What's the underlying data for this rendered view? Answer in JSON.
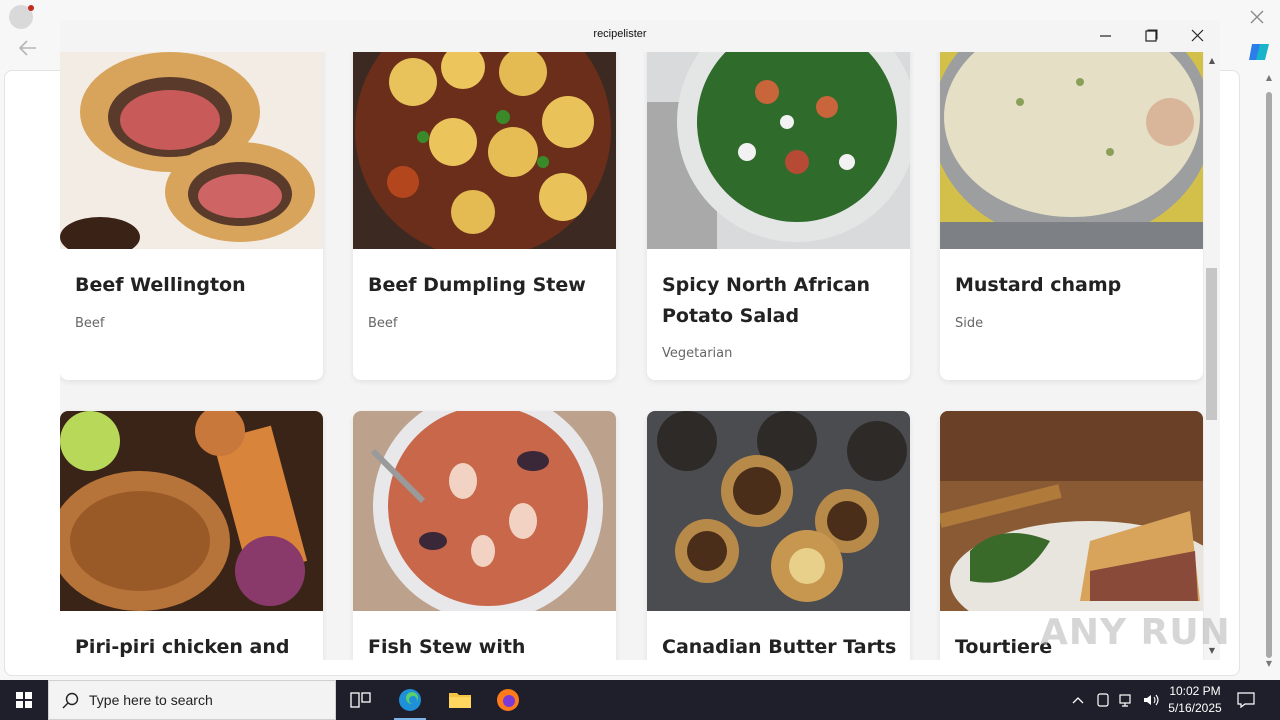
{
  "app": {
    "title": "recipelister"
  },
  "recipes": [
    {
      "name": "Beef Wellington",
      "category": "Beef",
      "image_icon": "beef-wellington-photo"
    },
    {
      "name": "Beef Dumpling Stew",
      "category": "Beef",
      "image_icon": "beef-dumpling-stew-photo"
    },
    {
      "name": "Spicy North African Potato Salad",
      "category": "Vegetarian",
      "image_icon": "potato-salad-photo"
    },
    {
      "name": "Mustard champ",
      "category": "Side",
      "image_icon": "mustard-champ-photo"
    },
    {
      "name": "Piri-piri chicken and",
      "category": "",
      "image_icon": "piri-piri-chicken-photo"
    },
    {
      "name": "Fish Stew with Rouille",
      "category": "",
      "image_icon": "fish-stew-photo"
    },
    {
      "name": "Canadian Butter Tarts",
      "category": "",
      "image_icon": "butter-tarts-photo"
    },
    {
      "name": "Tourtiere",
      "category": "",
      "image_icon": "tourtiere-photo"
    }
  ],
  "taskbar": {
    "search_placeholder": "Type here to search",
    "time": "10:02 PM",
    "date": "5/16/2025"
  },
  "watermark": "ANY RUN",
  "colors": {
    "card_bg": "#ffffff",
    "app_bg": "#f4f4f4",
    "taskbar_bg": "#1f1f2b"
  }
}
